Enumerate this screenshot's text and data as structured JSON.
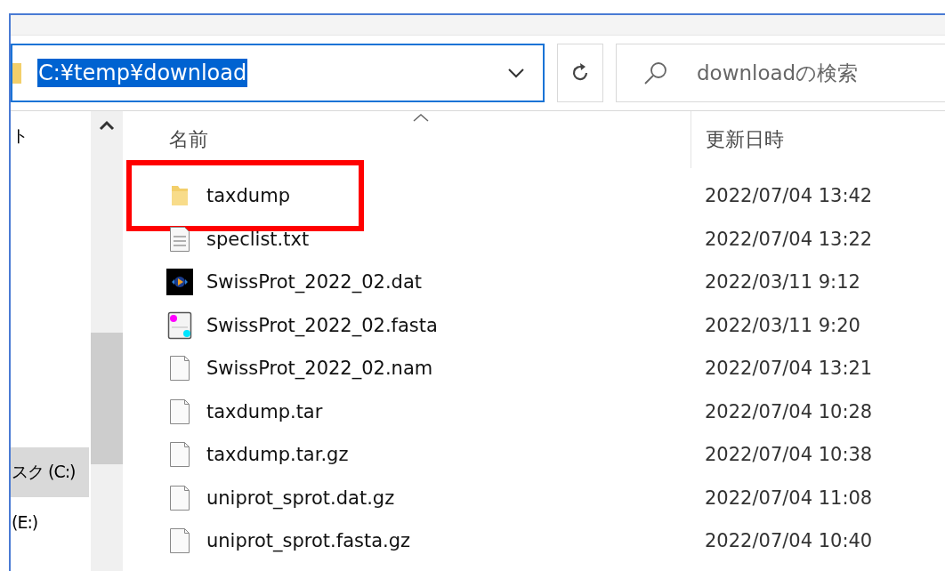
{
  "address_bar": {
    "path": "C:¥temp¥download",
    "path_selected": true
  },
  "search": {
    "placeholder": "downloadの検索"
  },
  "sidebar": {
    "items": [
      {
        "label": "ト",
        "selected": false
      },
      {
        "label": "スク (C:)",
        "selected": true
      },
      {
        "label": "(E:)",
        "selected": false
      }
    ]
  },
  "file_list": {
    "columns": [
      "名前",
      "更新日時"
    ],
    "rows": [
      {
        "name": "taxdump",
        "modified": "2022/07/04 13:42",
        "kind": "folder",
        "highlighted": true
      },
      {
        "name": "speclist.txt",
        "modified": "2022/07/04 13:22",
        "kind": "text",
        "highlighted": false
      },
      {
        "name": "SwissProt_2022_02.dat",
        "modified": "2022/03/11 9:12",
        "kind": "media",
        "highlighted": false
      },
      {
        "name": "SwissProt_2022_02.fasta",
        "modified": "2022/03/11 9:20",
        "kind": "image",
        "highlighted": false
      },
      {
        "name": "SwissProt_2022_02.nam",
        "modified": "2022/07/04 13:21",
        "kind": "blank",
        "highlighted": false
      },
      {
        "name": "taxdump.tar",
        "modified": "2022/07/04 10:28",
        "kind": "blank",
        "highlighted": false
      },
      {
        "name": "taxdump.tar.gz",
        "modified": "2022/07/04 10:38",
        "kind": "blank",
        "highlighted": false
      },
      {
        "name": "uniprot_sprot.dat.gz",
        "modified": "2022/07/04 11:08",
        "kind": "blank",
        "highlighted": false
      },
      {
        "name": "uniprot_sprot.fasta.gz",
        "modified": "2022/07/04 10:40",
        "kind": "blank",
        "highlighted": false
      }
    ]
  }
}
